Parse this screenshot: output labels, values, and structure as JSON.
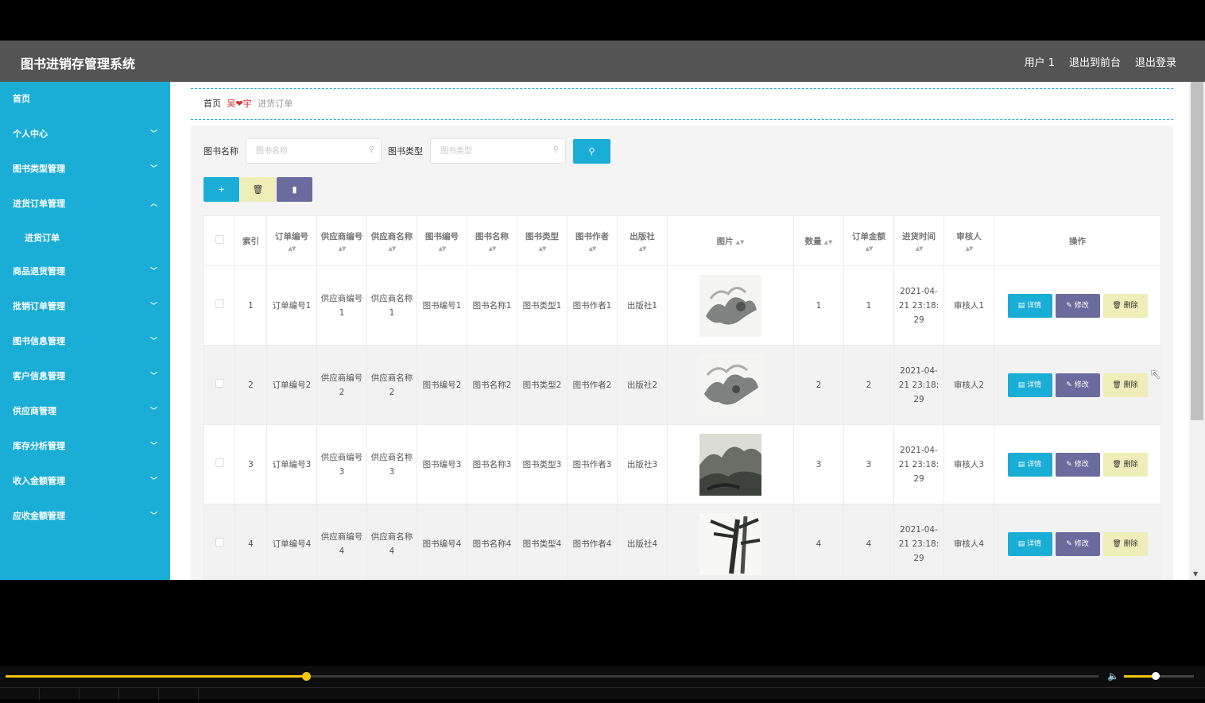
{
  "header": {
    "title": "图书进销存管理系统",
    "nav": [
      "用户 1",
      "退出到前台",
      "退出登录"
    ]
  },
  "sidebar": {
    "items": [
      {
        "label": "首页",
        "chevron": ""
      },
      {
        "label": "个人中心",
        "chevron": "down"
      },
      {
        "label": "图书类型管理",
        "chevron": "down"
      },
      {
        "label": "进货订单管理",
        "chevron": "up"
      },
      {
        "label": "进货订单",
        "chevron": "",
        "sub": true
      },
      {
        "label": "商品退货管理",
        "chevron": "down"
      },
      {
        "label": "批销订单管理",
        "chevron": "down"
      },
      {
        "label": "图书信息管理",
        "chevron": "down"
      },
      {
        "label": "客户信息管理",
        "chevron": "down"
      },
      {
        "label": "供应商管理",
        "chevron": "down"
      },
      {
        "label": "库存分析管理",
        "chevron": "down"
      },
      {
        "label": "收入金额管理",
        "chevron": "down"
      },
      {
        "label": "应收金额管理",
        "chevron": "down"
      }
    ]
  },
  "breadcrumb": {
    "home": "首页",
    "separator": "吴❤宇",
    "current": "进货订单"
  },
  "search": {
    "name_label": "图书名称",
    "name_placeholder": "图书名称",
    "type_label": "图书类型",
    "type_placeholder": "图书类型"
  },
  "table": {
    "headers": [
      "索引",
      "订单编号",
      "供应商编号",
      "供应商名称",
      "图书编号",
      "图书名称",
      "图书类型",
      "图书作者",
      "出版社",
      "图片",
      "数量",
      "订单金额",
      "进货时间",
      "审核人",
      "操作"
    ],
    "rows": [
      {
        "index": "1",
        "order_no": "订单编号1",
        "supplier_no": "供应商编号1",
        "supplier_name": "供应商名称1",
        "book_no": "图书编号1",
        "book_name": "图书名称1",
        "book_type": "图书类型1",
        "author": "图书作者1",
        "publisher": "出版社1",
        "qty": "1",
        "amount": "1",
        "time": "2021-04-21 23:18:29",
        "reviewer": "审核人1"
      },
      {
        "index": "2",
        "order_no": "订单编号2",
        "supplier_no": "供应商编号2",
        "supplier_name": "供应商名称2",
        "book_no": "图书编号2",
        "book_name": "图书名称2",
        "book_type": "图书类型2",
        "author": "图书作者2",
        "publisher": "出版社2",
        "qty": "2",
        "amount": "2",
        "time": "2021-04-21 23:18:29",
        "reviewer": "审核人2"
      },
      {
        "index": "3",
        "order_no": "订单编号3",
        "supplier_no": "供应商编号3",
        "supplier_name": "供应商名称3",
        "book_no": "图书编号3",
        "book_name": "图书名称3",
        "book_type": "图书类型3",
        "author": "图书作者3",
        "publisher": "出版社3",
        "qty": "3",
        "amount": "3",
        "time": "2021-04-21 23:18:29",
        "reviewer": "审核人3"
      },
      {
        "index": "4",
        "order_no": "订单编号4",
        "supplier_no": "供应商编号4",
        "supplier_name": "供应商名称4",
        "book_no": "图书编号4",
        "book_name": "图书名称4",
        "book_type": "图书类型4",
        "author": "图书作者4",
        "publisher": "出版社4",
        "qty": "4",
        "amount": "4",
        "time": "2021-04-21 23:18:29",
        "reviewer": "审核人4"
      }
    ],
    "ops": {
      "detail": "详情",
      "edit": "修改",
      "delete": "删除"
    }
  },
  "colors": {
    "primary": "#1aadd5",
    "header_bg": "#545454",
    "edit": "#6b6b9e",
    "delete": "#efedb8",
    "player_accent": "#f1c40f"
  },
  "player": {
    "progress": 0.275,
    "volume": 0.45
  }
}
